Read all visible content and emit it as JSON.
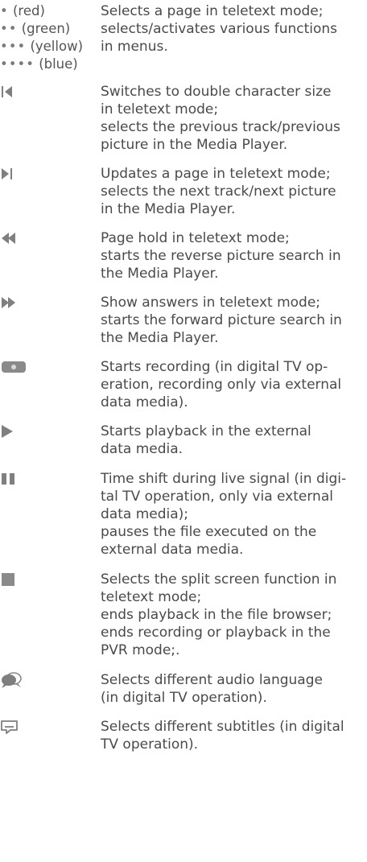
{
  "color_buttons": {
    "items": [
      {
        "dots": "•",
        "name": "(red)"
      },
      {
        "dots": "••",
        "name": "(green)"
      },
      {
        "dots": "•••",
        "name": "(yellow)"
      },
      {
        "dots": "••••",
        "name": "(blue)"
      }
    ],
    "description": [
      "Selects a page in teletext mode;",
      "selects/activates various functions",
      "in menus."
    ]
  },
  "rows": [
    {
      "icon": "skip-previous-icon",
      "lines": [
        "Switches to double character size",
        "in teletext mode;",
        "selects the previous track/previous",
        "picture in the Media Player."
      ]
    },
    {
      "icon": "skip-next-icon",
      "lines": [
        "Updates a page in teletext mode;",
        "selects the next track/next picture",
        "in the Media Player."
      ]
    },
    {
      "icon": "rewind-icon",
      "lines": [
        "Page hold in teletext mode;",
        "starts the reverse picture search in",
        "the Media Player."
      ]
    },
    {
      "icon": "fast-forward-icon",
      "lines": [
        "Show answers in teletext mode;",
        "starts the forward picture search in",
        "the Media Player."
      ]
    },
    {
      "icon": "record-icon",
      "lines": [
        "Starts recording (in digital TV op-",
        "eration, recording only via external",
        "data media)."
      ]
    },
    {
      "icon": "play-icon",
      "lines": [
        "Starts playback in the external",
        "data media."
      ]
    },
    {
      "icon": "pause-icon",
      "lines": [
        "Time shift during live signal (in digi-",
        "tal TV operation, only via external",
        "data media);",
        "pauses the file executed on the",
        "external data media."
      ]
    },
    {
      "icon": "stop-icon",
      "lines": [
        "Selects the split screen function in",
        "teletext mode;",
        "ends playback in the file browser;",
        "ends recording or playback in the",
        "PVR mode;."
      ]
    },
    {
      "icon": "audio-language-icon",
      "lines": [
        "Selects different audio language",
        "(in digital TV operation)."
      ]
    },
    {
      "icon": "subtitles-icon",
      "lines": [
        "Selects different subtitles (in digital",
        "TV operation)."
      ]
    }
  ],
  "colors": {
    "text": "#4a4a4a",
    "icon": "#7f7f7f"
  }
}
